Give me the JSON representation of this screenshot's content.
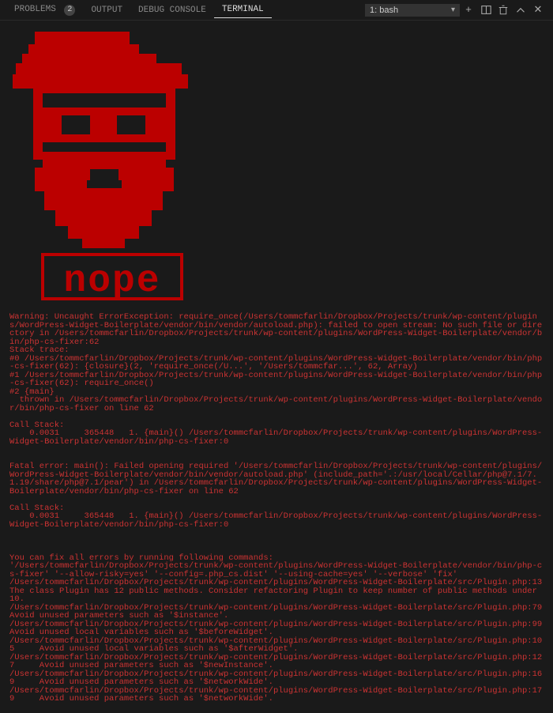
{
  "tabs": {
    "problems": {
      "label": "PROBLEMS",
      "badge": "2"
    },
    "output": {
      "label": "OUTPUT"
    },
    "debug": {
      "label": "DEBUG CONSOLE"
    },
    "terminal": {
      "label": "TERMINAL"
    }
  },
  "terminal_selector": {
    "selected": "1: bash"
  },
  "ascii_nope_label": "nope",
  "error_lines": [
    "Warning: Uncaught ErrorException: require_once(/Users/tommcfarlin/Dropbox/Projects/trunk/wp-content/plugins/WordPress-Widget-Boilerplate/vendor/bin/vendor/autoload.php): failed to open stream: No such file or directory in /Users/tommcfarlin/Dropbox/Projects/trunk/wp-content/plugins/WordPress-Widget-Boilerplate/vendor/bin/php-cs-fixer:62",
    "Stack trace:",
    "#0 /Users/tommcfarlin/Dropbox/Projects/trunk/wp-content/plugins/WordPress-Widget-Boilerplate/vendor/bin/php-cs-fixer(62): {closure}(2, 'require_once(/U...', '/Users/tommcfar...', 62, Array)",
    "#1 /Users/tommcfarlin/Dropbox/Projects/trunk/wp-content/plugins/WordPress-Widget-Boilerplate/vendor/bin/php-cs-fixer(62): require_once()",
    "#2 {main}",
    "  thrown in /Users/tommcfarlin/Dropbox/Projects/trunk/wp-content/plugins/WordPress-Widget-Boilerplate/vendor/bin/php-cs-fixer on line 62",
    "",
    "Call Stack:",
    "    0.0031     365448   1. {main}() /Users/tommcfarlin/Dropbox/Projects/trunk/wp-content/plugins/WordPress-Widget-Boilerplate/vendor/bin/php-cs-fixer:0",
    "",
    "",
    "Fatal error: main(): Failed opening required '/Users/tommcfarlin/Dropbox/Projects/trunk/wp-content/plugins/WordPress-Widget-Boilerplate/vendor/bin/vendor/autoload.php' (include_path='.:/usr/local/Cellar/php@7.1/7.1.19/share/php@7.1/pear') in /Users/tommcfarlin/Dropbox/Projects/trunk/wp-content/plugins/WordPress-Widget-Boilerplate/vendor/bin/php-cs-fixer on line 62",
    "",
    "Call Stack:",
    "    0.0031     365448   1. {main}() /Users/tommcfarlin/Dropbox/Projects/trunk/wp-content/plugins/WordPress-Widget-Boilerplate/vendor/bin/php-cs-fixer:0",
    "",
    "",
    "",
    "You can fix all errors by running following commands:",
    "'/Users/tommcfarlin/Dropbox/Projects/trunk/wp-content/plugins/WordPress-Widget-Boilerplate/vendor/bin/php-cs-fixer' '--allow-risky=yes' '--config=.php_cs.dist' '--using-cache=yes' '--verbose' 'fix'",
    "/Users/tommcfarlin/Dropbox/Projects/trunk/wp-content/plugins/WordPress-Widget-Boilerplate/src/Plugin.php:13      The class Plugin has 12 public methods. Consider refactoring Plugin to keep number of public methods under 10.",
    "/Users/tommcfarlin/Dropbox/Projects/trunk/wp-content/plugins/WordPress-Widget-Boilerplate/src/Plugin.php:79      Avoid unused parameters such as '$instance'.",
    "/Users/tommcfarlin/Dropbox/Projects/trunk/wp-content/plugins/WordPress-Widget-Boilerplate/src/Plugin.php:99      Avoid unused local variables such as '$beforeWidget'.",
    "/Users/tommcfarlin/Dropbox/Projects/trunk/wp-content/plugins/WordPress-Widget-Boilerplate/src/Plugin.php:105     Avoid unused local variables such as '$afterWidget'.",
    "/Users/tommcfarlin/Dropbox/Projects/trunk/wp-content/plugins/WordPress-Widget-Boilerplate/src/Plugin.php:127     Avoid unused parameters such as '$newInstance'.",
    "/Users/tommcfarlin/Dropbox/Projects/trunk/wp-content/plugins/WordPress-Widget-Boilerplate/src/Plugin.php:169     Avoid unused parameters such as '$networkWide'.",
    "/Users/tommcfarlin/Dropbox/Projects/trunk/wp-content/plugins/WordPress-Widget-Boilerplate/src/Plugin.php:179     Avoid unused parameters such as '$networkWide'."
  ]
}
